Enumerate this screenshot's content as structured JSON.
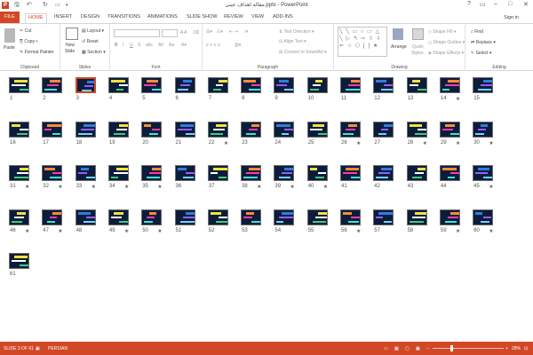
{
  "window": {
    "title": "مقاله اهداف عینی.pptx - PowerPoint",
    "app_icon": "P",
    "controls": [
      "?",
      "▭",
      "–",
      "□",
      "✕"
    ]
  },
  "tabs": [
    "FILE",
    "HOME",
    "INSERT",
    "DESIGN",
    "TRANSITIONS",
    "ANIMATIONS",
    "SLIDE SHOW",
    "REVIEW",
    "VIEW",
    "ADD-INS"
  ],
  "signin": "Sign in",
  "ribbon": {
    "clipboard": {
      "label": "Clipboard",
      "paste": "Paste",
      "cut": "Cut",
      "copy": "Copy",
      "format_painter": "Format Painter"
    },
    "slides": {
      "label": "Slides",
      "new_slide": "New",
      "new_slide2": "Slide",
      "layout": "Layout",
      "reset": "Reset",
      "section": "Section"
    },
    "font": {
      "label": "Font"
    },
    "paragraph": {
      "label": "Paragraph",
      "text_direction": "Text Direction",
      "align_text": "Align Text",
      "convert": "Convert to SmartArt"
    },
    "drawing": {
      "label": "Drawing",
      "arrange": "Arrange",
      "quick_styles": "Quick",
      "quick_styles2": "Styles",
      "shape_fill": "Shape Fill",
      "shape_outline": "Shape Outline",
      "shape_effects": "Shape Effects"
    },
    "editing": {
      "label": "Editing",
      "find": "Find",
      "replace": "Replace",
      "select": "Select"
    }
  },
  "slides": [
    {
      "n": "1",
      "star": false
    },
    {
      "n": "2",
      "star": false
    },
    {
      "n": "3",
      "star": false
    },
    {
      "n": "4",
      "star": false
    },
    {
      "n": "5",
      "star": false
    },
    {
      "n": "6",
      "star": false
    },
    {
      "n": "7",
      "star": false
    },
    {
      "n": "8",
      "star": false
    },
    {
      "n": "9",
      "star": false
    },
    {
      "n": "10",
      "star": false
    },
    {
      "n": "11",
      "star": false
    },
    {
      "n": "12",
      "star": false
    },
    {
      "n": "13",
      "star": false
    },
    {
      "n": "14",
      "star": true
    },
    {
      "n": "15",
      "star": false
    },
    {
      "n": "16",
      "star": false
    },
    {
      "n": "17",
      "star": false
    },
    {
      "n": "18",
      "star": false
    },
    {
      "n": "19",
      "star": false
    },
    {
      "n": "20",
      "star": false
    },
    {
      "n": "21",
      "star": false
    },
    {
      "n": "22",
      "star": true
    },
    {
      "n": "23",
      "star": false
    },
    {
      "n": "24",
      "star": false
    },
    {
      "n": "25",
      "star": false
    },
    {
      "n": "26",
      "star": true
    },
    {
      "n": "27",
      "star": false
    },
    {
      "n": "28",
      "star": true
    },
    {
      "n": "29",
      "star": true
    },
    {
      "n": "30",
      "star": true
    },
    {
      "n": "31",
      "star": true
    },
    {
      "n": "32",
      "star": true
    },
    {
      "n": "33",
      "star": true
    },
    {
      "n": "34",
      "star": true
    },
    {
      "n": "35",
      "star": true
    },
    {
      "n": "36",
      "star": false
    },
    {
      "n": "37",
      "star": false
    },
    {
      "n": "38",
      "star": true
    },
    {
      "n": "39",
      "star": true
    },
    {
      "n": "40",
      "star": true
    },
    {
      "n": "41",
      "star": false
    },
    {
      "n": "42",
      "star": false
    },
    {
      "n": "43",
      "star": false
    },
    {
      "n": "44",
      "star": false
    },
    {
      "n": "45",
      "star": true
    },
    {
      "n": "46",
      "star": true
    },
    {
      "n": "47",
      "star": true
    },
    {
      "n": "48",
      "star": false
    },
    {
      "n": "49",
      "star": true
    },
    {
      "n": "50",
      "star": true
    },
    {
      "n": "51",
      "star": false
    },
    {
      "n": "52",
      "star": false
    },
    {
      "n": "53",
      "star": false
    },
    {
      "n": "54",
      "star": false
    },
    {
      "n": "55",
      "star": false
    },
    {
      "n": "56",
      "star": true
    },
    {
      "n": "57",
      "star": false
    },
    {
      "n": "58",
      "star": false
    },
    {
      "n": "59",
      "star": true
    },
    {
      "n": "60",
      "star": true
    },
    {
      "n": "61",
      "star": false
    }
  ],
  "selected_slide": "3",
  "status": {
    "slide_info": "SLIDE 3 OF 61",
    "language": "PERSIAN",
    "zoom": "28%"
  },
  "colors": {
    "accent": "#d24726",
    "slide_bg": "#0c1d3c"
  }
}
